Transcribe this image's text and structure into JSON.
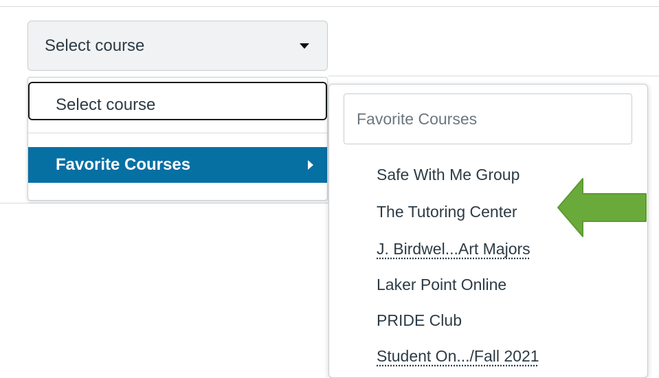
{
  "course_select": {
    "label": "Select course",
    "icon": "caret-down-icon"
  },
  "menu": {
    "items": [
      {
        "label": "Select course"
      },
      {
        "label": "Favorite Courses",
        "icon": "caret-right-icon"
      }
    ]
  },
  "submenu": {
    "search_placeholder": "Favorite Courses",
    "courses": [
      {
        "label": "Safe With Me Group"
      },
      {
        "label": "The Tutoring Center"
      },
      {
        "label": "J. Birdwel...Art Majors"
      },
      {
        "label": "Laker Point Online"
      },
      {
        "label": "PRIDE Club"
      },
      {
        "label": "Student On.../Fall 2021"
      }
    ]
  },
  "colors": {
    "highlight": "#0770a3",
    "arrow": "#6aaa3a"
  }
}
